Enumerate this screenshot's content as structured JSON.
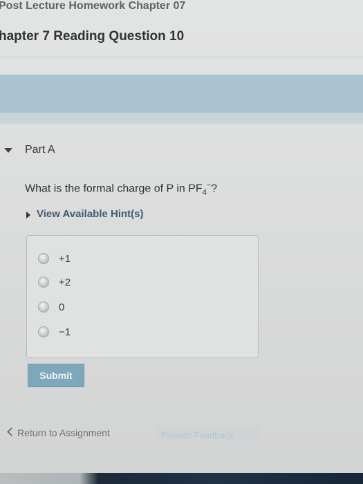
{
  "header": {
    "breadcrumb": "Post Lecture Homework Chapter 07",
    "title": "hapter 7 Reading Question 10"
  },
  "part": {
    "label": "Part A"
  },
  "question": {
    "prefix": "What is the formal charge of P in PF",
    "subscript": "4",
    "superscript": "−",
    "suffix": "?"
  },
  "hints": {
    "label": "View Available Hint(s)"
  },
  "options": [
    {
      "label": "+1"
    },
    {
      "label": "+2"
    },
    {
      "label": "0"
    },
    {
      "label": "−1"
    }
  ],
  "actions": {
    "submit_label": "Submit",
    "return_label": "Return to Assignment",
    "feedback_label": "Provide Feedback"
  },
  "colors": {
    "accent": "#7fa7bb",
    "link": "#3f5c6e",
    "band": "#a9c3d3"
  }
}
